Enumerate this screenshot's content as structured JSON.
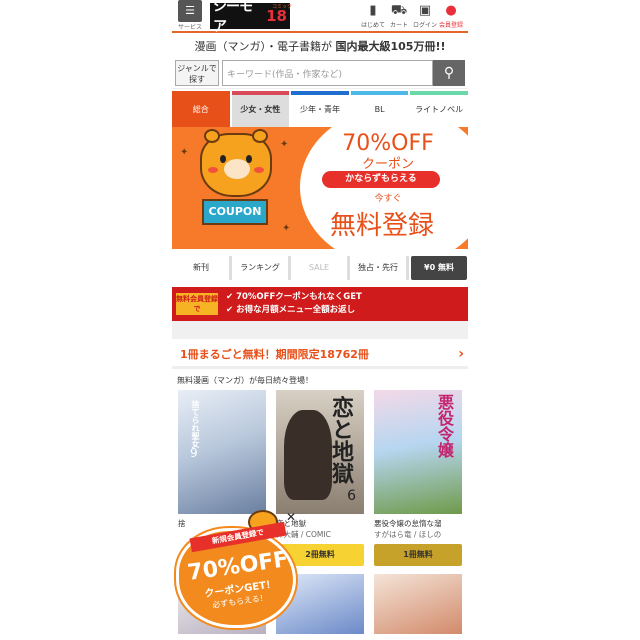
{
  "header": {
    "service_label": "サービス",
    "logo_text": "シーモア",
    "logo_small": "コミック",
    "logo_num": "18",
    "nav": [
      {
        "icon": "book-icon",
        "label": "はじめて"
      },
      {
        "icon": "cart-icon",
        "label": "カート"
      },
      {
        "icon": "lock-icon",
        "label": "ログイン"
      },
      {
        "icon": "person-icon",
        "label": "会員登録"
      }
    ]
  },
  "tagline": {
    "pre": "漫画（マンガ）・電子書籍が",
    "bold": "国内最大級105万冊!!"
  },
  "search": {
    "genre_label": "ジャンルで探す",
    "placeholder": "キーワード(作品・作家など)"
  },
  "tabs": [
    "総合",
    "少女・女性",
    "少年・青年",
    "BL",
    "ライトノベル"
  ],
  "banner": {
    "coupon": "COUPON",
    "percent": "70%OFF",
    "coupon_jp": "クーポン",
    "kanarazu": "かならずもらえる",
    "imasugu": "今すぐ",
    "muryo": "無料登録"
  },
  "subtabs": [
    "新刊",
    "ランキング",
    "SALE",
    "独占・先行",
    "¥0 無料"
  ],
  "redbar": {
    "badge": "無料会員登録で",
    "line1": "✔ 70%OFFクーポンもれなくGET",
    "line2": "✔ お得な月額メニュー全額お返し"
  },
  "freeline": {
    "text": "1冊まるごと無料！期間限定18762冊",
    "chev": "›"
  },
  "daily": "無料漫画（マンガ）が毎日続々登場！",
  "books": [
    {
      "title": "捨てられ聖女",
      "vol": "9",
      "info_title": "捨",
      "info_author": "",
      "button": ""
    },
    {
      "title": "恋と地獄",
      "vol": "6",
      "info_title": "恋と地獄",
      "info_author": "梓大輔 / COMIC",
      "button": "2冊無料"
    },
    {
      "title": "悪役令嬢",
      "vol": "",
      "info_title": "悪役令嬢の怠惰な溜",
      "info_author": "すがはら竜 / ほしの",
      "button": "1冊無料"
    }
  ],
  "promo": {
    "ribbon": "新規会員登録で",
    "big": "70%OFF",
    "cg": "クーポンGET！",
    "must": "必ずもらえる！",
    "close": "✕"
  }
}
